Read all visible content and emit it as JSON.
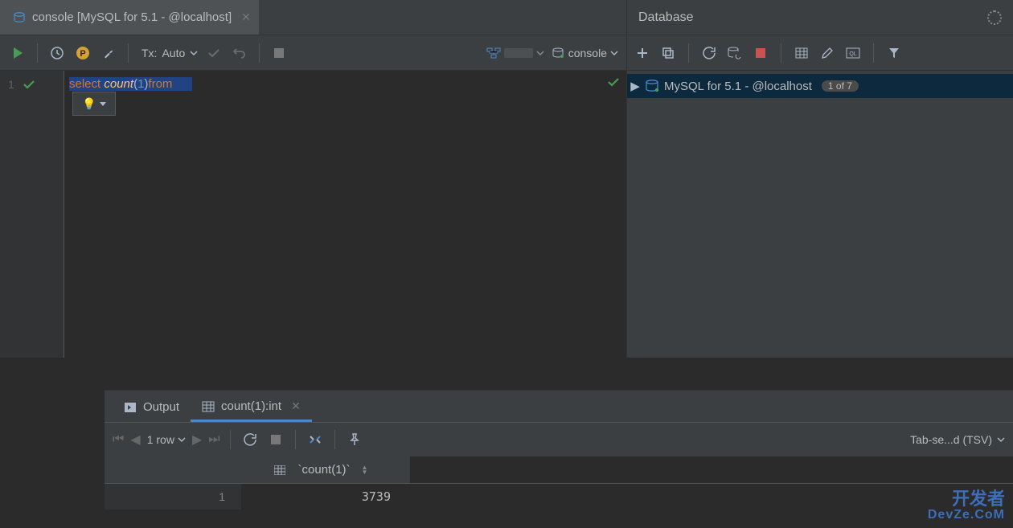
{
  "editor": {
    "tab_title": "console [MySQL for 5.1 -          @localhost]",
    "tx_label": "Tx:",
    "tx_mode": "Auto",
    "schema_label": "",
    "console_label": "console",
    "line_number": "1",
    "code_tokens": {
      "select": "select ",
      "count": "count",
      "open": "(",
      "one": "1",
      "close": ")",
      "from": "from ",
      "table": "     "
    }
  },
  "database": {
    "title": "Database",
    "ds_label": "MySQL for 5.1 -         @localhost",
    "ds_badge": "1 of 7"
  },
  "results": {
    "output_tab": "Output",
    "result_tab": "count(1):int",
    "row_count": "1 row",
    "col_header": "`count(1)`",
    "row_number": "1",
    "cell_value": "3739",
    "export_label": "Tab-se...d (TSV)"
  },
  "watermark": {
    "line1": "开发者",
    "line2": "DevZe.CoM"
  }
}
